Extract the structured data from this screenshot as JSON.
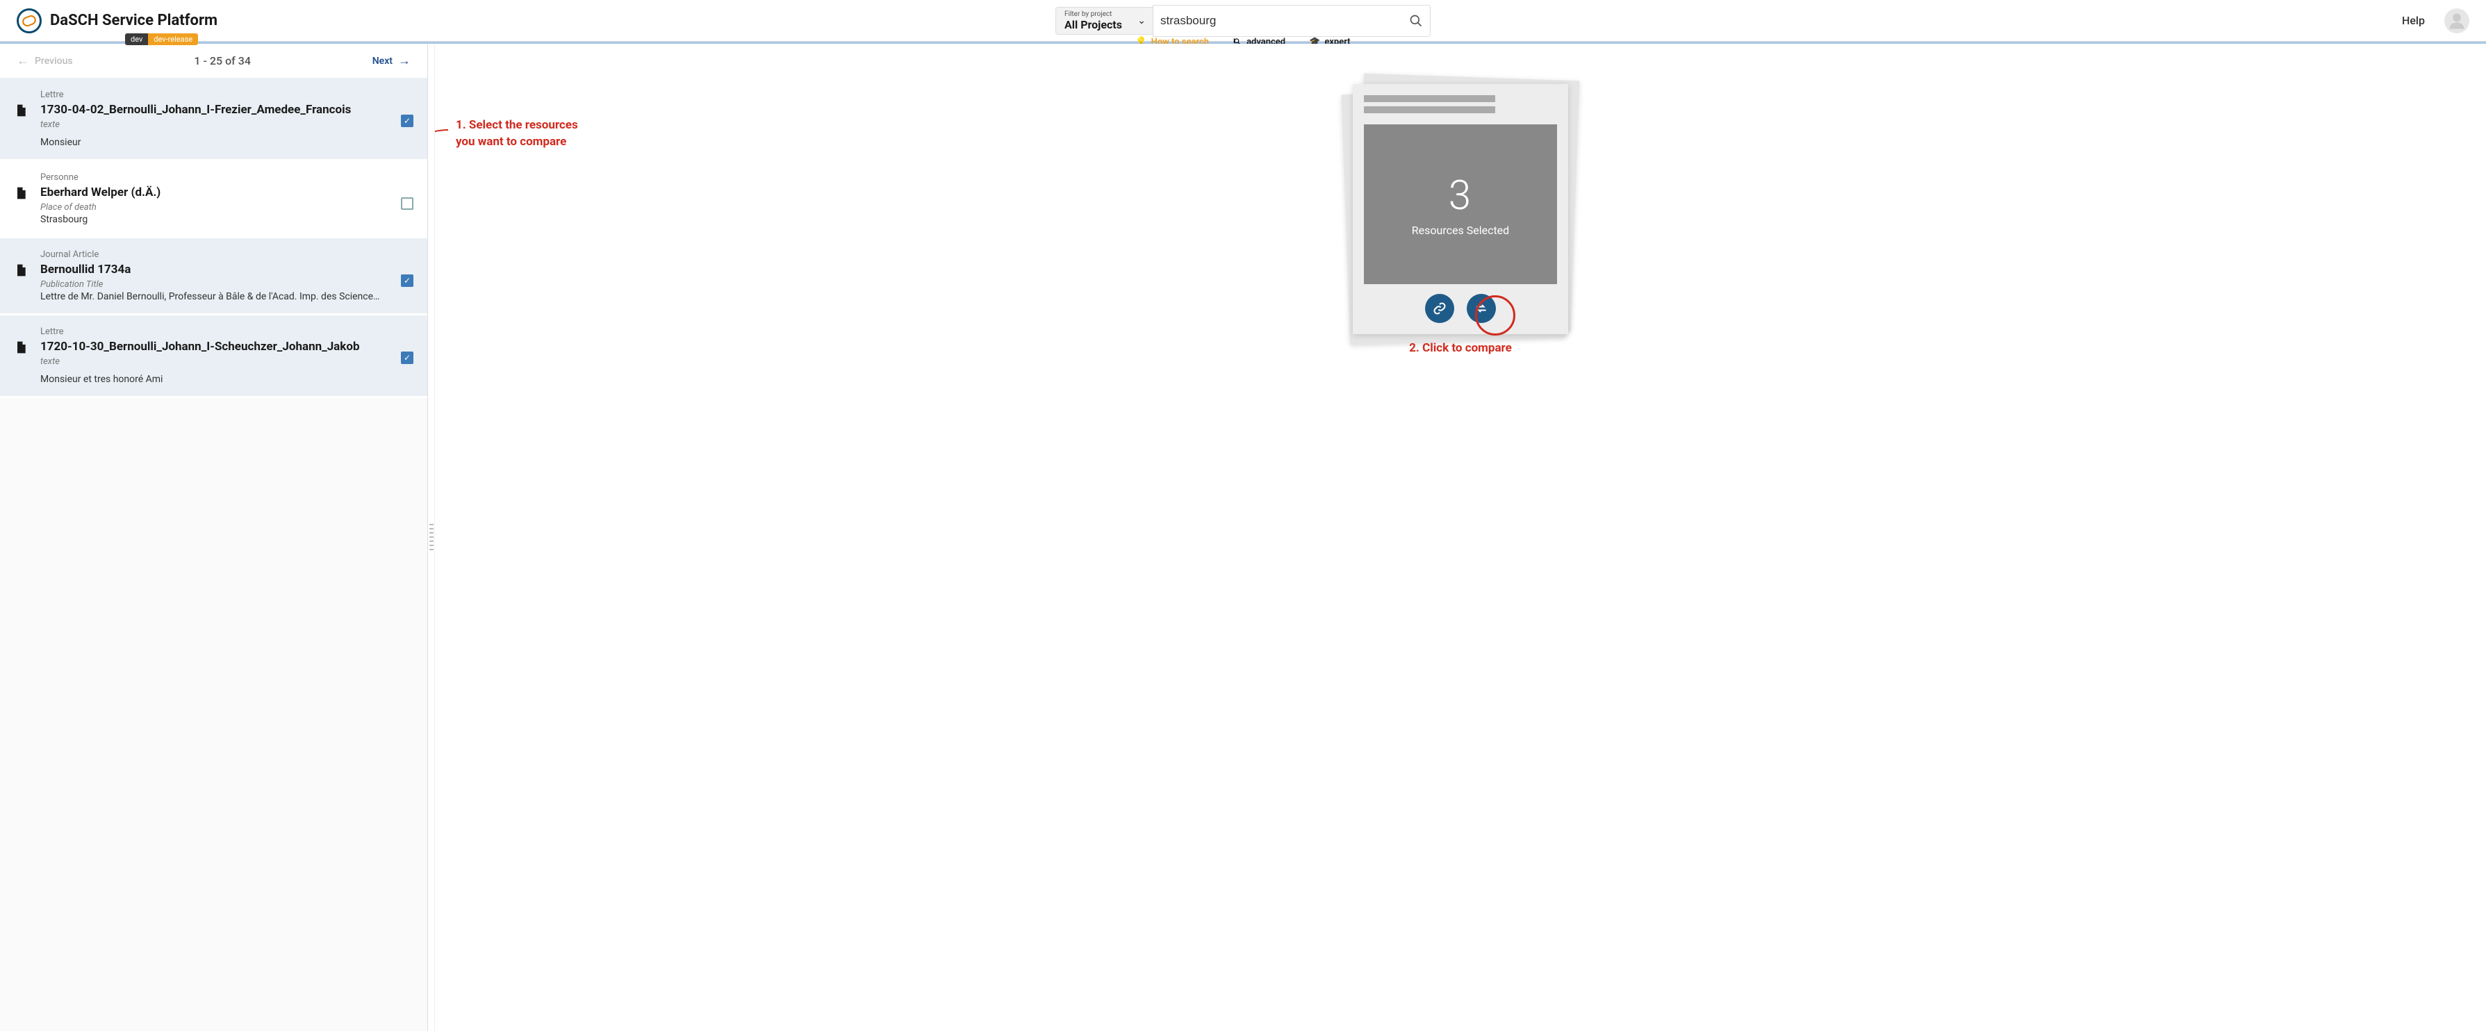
{
  "brand": {
    "name": "DaSCH Service Platform",
    "badge_dev": "dev",
    "badge_release": "dev-release"
  },
  "filter": {
    "label": "Filter by project",
    "value": "All Projects"
  },
  "search": {
    "query": "strasbourg"
  },
  "sublinks": {
    "how": "How to search",
    "advanced": "advanced",
    "expert": "expert"
  },
  "help_link": "Help",
  "pagination": {
    "prev": "Previous",
    "range": "1 - 25 of 34",
    "next": "Next"
  },
  "results": [
    {
      "type": "Lettre",
      "title": "1730-04-02_Bernoulli_Johann_I-Frezier_Amedee_Francois",
      "field_label": "texte",
      "field_value": "",
      "extra": "Monsieur",
      "checked": true
    },
    {
      "type": "Personne",
      "title": "Eberhard Welper (d.Ä.)",
      "field_label": "Place of death",
      "field_value": "Strasbourg",
      "extra": "",
      "checked": false
    },
    {
      "type": "Journal Article",
      "title": "Bernoullid 1734a",
      "field_label": "Publication Title",
      "field_value": "Lettre de Mr. Daniel Bernoulli, Professeur à Bâle & de l'Acad. Imp. des Sciences de Petersb…",
      "extra": "",
      "checked": true
    },
    {
      "type": "Lettre",
      "title": "1720-10-30_Bernoulli_Johann_I-Scheuchzer_Johann_Jakob",
      "field_label": "texte",
      "field_value": "",
      "extra": "Monsieur et tres honoré Ami",
      "checked": true
    }
  ],
  "annotations": {
    "step1_line1": "1. Select the resources",
    "step1_line2": "you want to compare",
    "step2": "2. Click to compare"
  },
  "selection": {
    "count": "3",
    "label": "Resources Selected"
  }
}
